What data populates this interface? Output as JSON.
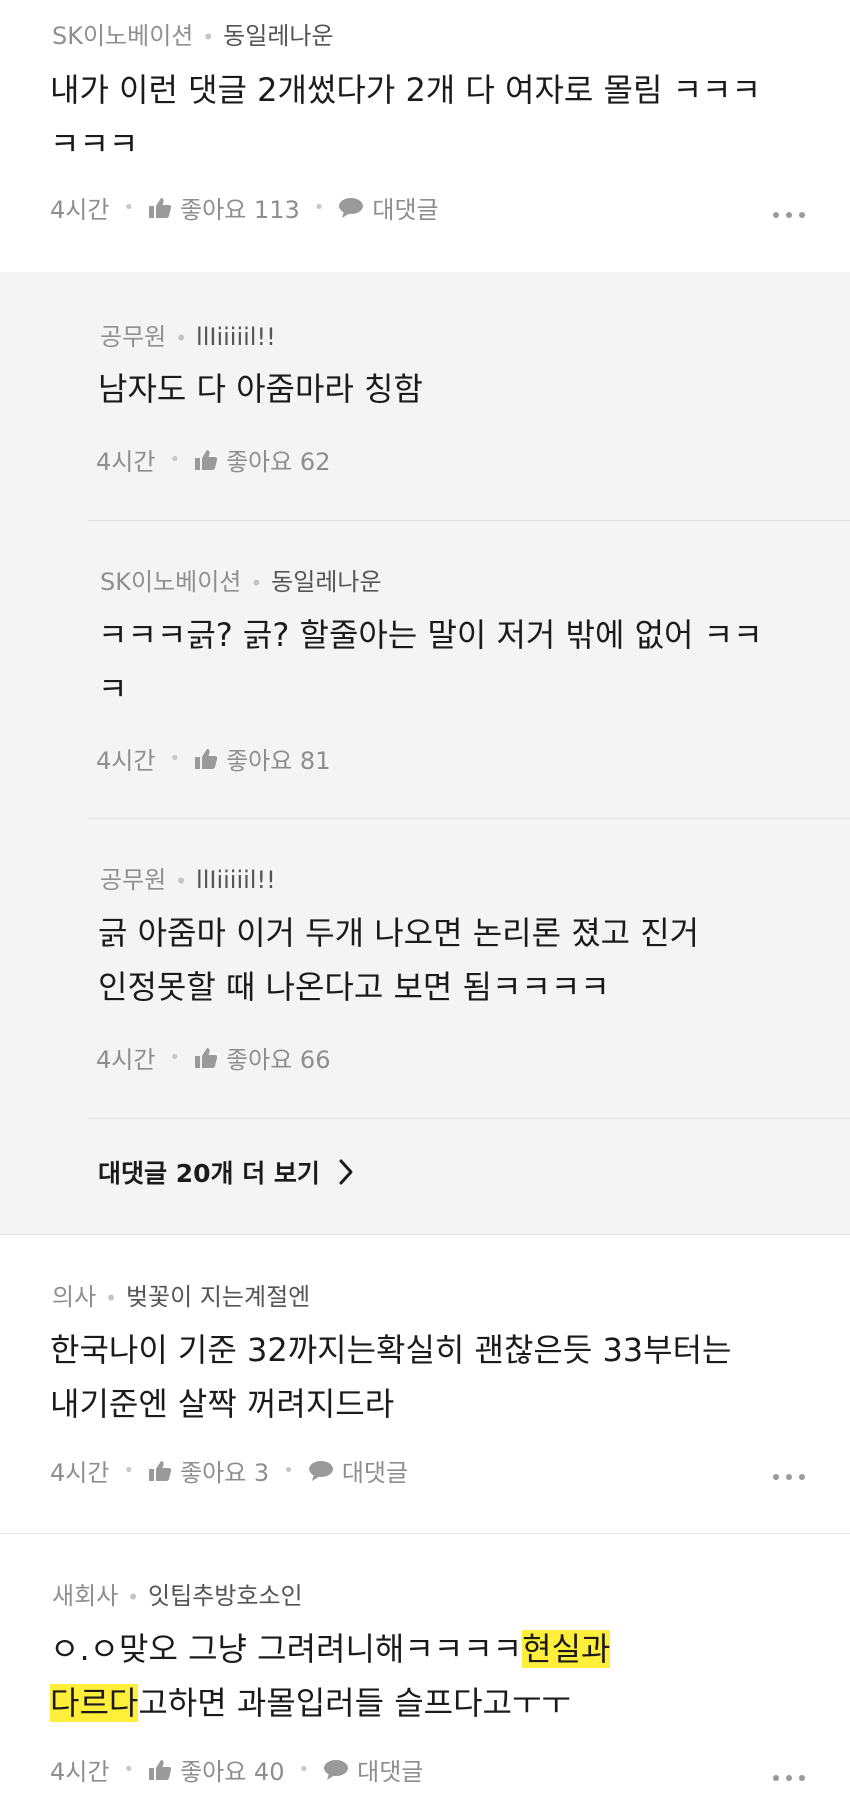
{
  "comments": [
    {
      "company": "SK이노베이션",
      "nickname": "동일레나운",
      "lines": [
        "내가 이런 댓글 2개썼다가 2개 다 여자로 몰림 ㅋㅋㅋ",
        "ㅋㅋㅋ"
      ],
      "time": "4시간",
      "like_label": "좋아요 113",
      "reply_label": "대댓글"
    },
    {
      "company": "의사",
      "nickname": "벚꽃이 지는계절엔",
      "lines": [
        "한국나이 기준 32까지는확실히 괜찮은듯 33부터는",
        "내기준엔 살짝 꺼려지드라"
      ],
      "time": "4시간",
      "like_label": "좋아요 3",
      "reply_label": "대댓글"
    },
    {
      "company": "새회사",
      "nickname": "잇팁추방호소인",
      "line1_plain": "ㅇ.ㅇ맞오 그냥 그려려니해ㅋㅋㅋㅋ",
      "line1_highlight": "현실과",
      "line2_highlight": "다르다",
      "line2_plain": "고하면 과몰입러들 슬프다고ㅜㅜ",
      "time": "4시간",
      "like_label": "좋아요 40",
      "reply_label": "대댓글"
    }
  ],
  "replies": [
    {
      "company": "공무원",
      "nickname": "llIiiiiil!!",
      "lines": [
        "남자도 다 아줌마라 칭함"
      ],
      "time": "4시간",
      "like_label": "좋아요 62"
    },
    {
      "company": "SK이노베이션",
      "nickname": "동일레나운",
      "lines": [
        "ㅋㅋㅋ긁? 긁? 할줄아는 말이 저거 밖에 없어 ㅋㅋ",
        "ㅋ"
      ],
      "time": "4시간",
      "like_label": "좋아요 81"
    },
    {
      "company": "공무원",
      "nickname": "llIiiiiil!!",
      "lines": [
        "긁 아줌마 이거 두개 나오면 논리론 졌고 진거",
        "인정못할 때 나온다고 보면 됨ㅋㅋㅋㅋ"
      ],
      "time": "4시간",
      "like_label": "좋아요 66"
    }
  ],
  "more_replies_label": "대댓글 20개 더 보기",
  "colors": {
    "highlight": "#ffef3b",
    "reply_bg": "#f4f4f4",
    "meta_text": "#8a8a8a"
  },
  "icons": [
    "thumbs-up-icon",
    "speech-bubble-icon",
    "more-dots-icon",
    "chevron-right-icon"
  ]
}
